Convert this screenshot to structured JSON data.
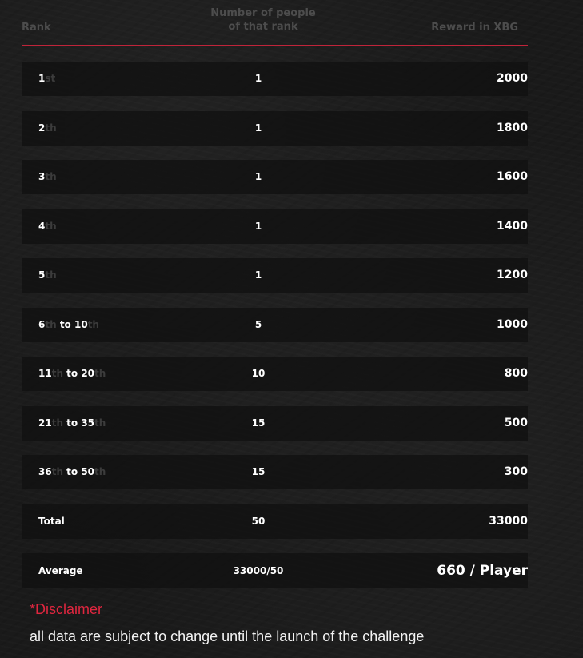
{
  "header": {
    "rank_label": "Rank",
    "count_label_line1": "Number of people",
    "count_label_line2": "of that rank",
    "reward_label": "Reward in XBG"
  },
  "rows": [
    {
      "rank_a": "1",
      "suffix_a": "st",
      "to": "",
      "rank_b": "",
      "suffix_b": "",
      "count": "1",
      "reward": "2000"
    },
    {
      "rank_a": "2",
      "suffix_a": "th",
      "to": "",
      "rank_b": "",
      "suffix_b": "",
      "count": "1",
      "reward": "1800"
    },
    {
      "rank_a": "3",
      "suffix_a": "th",
      "to": "",
      "rank_b": "",
      "suffix_b": "",
      "count": "1",
      "reward": "1600"
    },
    {
      "rank_a": "4",
      "suffix_a": "th",
      "to": "",
      "rank_b": "",
      "suffix_b": "",
      "count": "1",
      "reward": "1400"
    },
    {
      "rank_a": "5",
      "suffix_a": "th",
      "to": "",
      "rank_b": "",
      "suffix_b": "",
      "count": "1",
      "reward": "1200"
    },
    {
      "rank_a": "6",
      "suffix_a": "th",
      "to": " to ",
      "rank_b": "10",
      "suffix_b": "th",
      "count": "5",
      "reward": "1000"
    },
    {
      "rank_a": "11",
      "suffix_a": "th",
      "to": " to ",
      "rank_b": "20",
      "suffix_b": "th",
      "count": "10",
      "reward": "800"
    },
    {
      "rank_a": "21",
      "suffix_a": "th",
      "to": " to ",
      "rank_b": "35",
      "suffix_b": "th",
      "count": "15",
      "reward": "500"
    },
    {
      "rank_a": "36",
      "suffix_a": "th",
      "to": " to ",
      "rank_b": "50",
      "suffix_b": "th",
      "count": "15",
      "reward": "300"
    }
  ],
  "total": {
    "label": "Total",
    "count": "50",
    "reward": "33000"
  },
  "average": {
    "label": "Average",
    "count": "33000/50",
    "reward": "660 / Player"
  },
  "disclaimer": {
    "title": "*Disclaimer",
    "text": "all data are subject to change until the launch of the challenge"
  },
  "colors": {
    "accent": "#e0263f",
    "divider": "#c0243a",
    "row_bg": "#111111",
    "header_text": "#4d4d4d",
    "suffix_text": "#3c3c3c"
  }
}
